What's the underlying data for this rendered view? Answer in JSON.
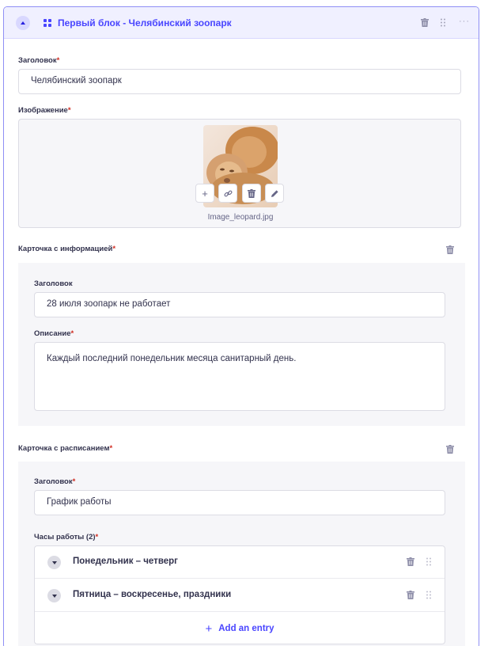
{
  "block": {
    "title": "Первый блок - Челябинский зоопарк",
    "more_label": "···"
  },
  "heading_field": {
    "label": "Заголовок",
    "required": "*",
    "value": "Челябинский зоопарк"
  },
  "image_field": {
    "label": "Изображение",
    "required": "*",
    "filename": "Image_leopard.jpg",
    "tools": [
      "plus-icon",
      "link-icon",
      "trash-icon",
      "pencil-icon"
    ]
  },
  "info_card": {
    "label": "Карточка с информацией",
    "required": "*",
    "heading_label": "Заголовок",
    "heading_value": "28 июля зоопарк не работает",
    "description_label": "Описание",
    "description_required": "*",
    "description_value": "Каждый последний понедельник месяца  санитарный день."
  },
  "schedule_card": {
    "label": "Карточка с расписанием",
    "required": "*",
    "heading_label": "Заголовок",
    "heading_required": "*",
    "heading_value": "График работы",
    "hours_label": "Часы работы (2)",
    "hours_required": "*",
    "entries": [
      {
        "label": "Понедельник – четверг"
      },
      {
        "label": "Пятница – воскресенье, праздники"
      }
    ],
    "add_entry_plus": "+",
    "add_entry_label": "Add an entry"
  },
  "colors": {
    "accent": "#4945ff",
    "header_bg": "#f0f0ff",
    "required": "#d02b20",
    "muted": "#666687",
    "panel_bg": "#f6f6f9"
  }
}
